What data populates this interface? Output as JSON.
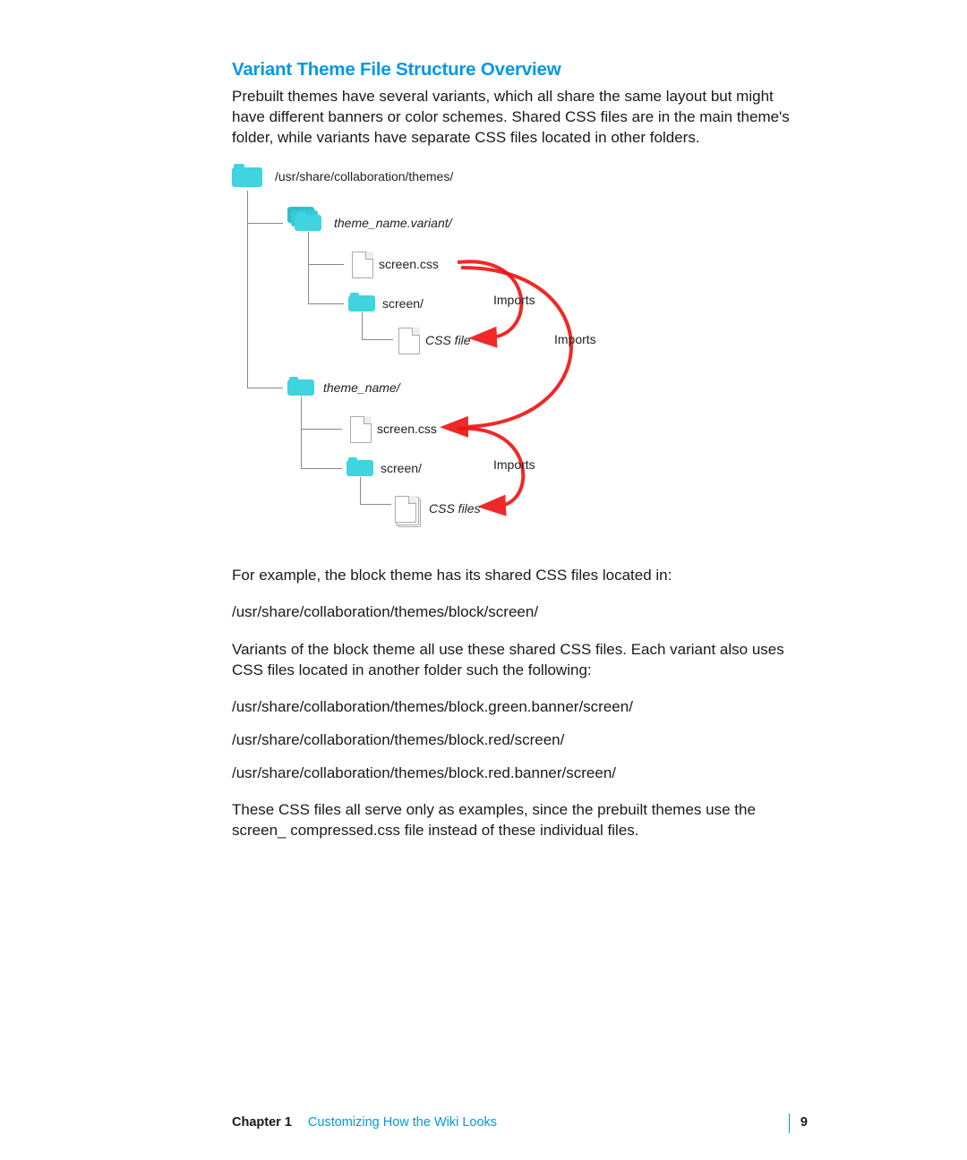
{
  "heading": "Variant Theme File Structure Overview",
  "intro": "Prebuilt themes have several variants, which all share the same layout but might have different banners or color schemes. Shared CSS files are in the main theme's folder, while variants have separate CSS files located in other folders.",
  "diagram": {
    "root": "/usr/share/collaboration/themes/",
    "variant_folder": "theme_name.variant/",
    "screen_css": "screen.css",
    "screen_folder": "screen/",
    "css_file": "CSS file",
    "theme_folder": "theme_name/",
    "css_files": "CSS files",
    "imports1": "Imports",
    "imports2": "Imports",
    "imports3": "Imports"
  },
  "para_example": "For example, the block theme has its shared CSS files located in:",
  "path1": "/usr/share/collaboration/themes/block/screen/",
  "para_variants": "Variants of the block theme all use these shared CSS files. Each variant also uses CSS files located in another folder such the following:",
  "path2": "/usr/share/collaboration/themes/block.green.banner/screen/",
  "path3": "/usr/share/collaboration/themes/block.red/screen/",
  "path4": "/usr/share/collaboration/themes/block.red.banner/screen/",
  "para_note": "These CSS files all serve only as examples, since the prebuilt themes use the screen_ compressed.css file instead of these individual files.",
  "footer": {
    "chapter": "Chapter 1",
    "title": "Customizing How the Wiki Looks",
    "page": "9"
  }
}
